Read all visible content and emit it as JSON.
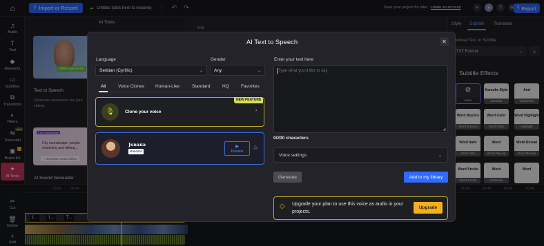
{
  "topbar": {
    "import_label": "Import or Record",
    "project_title": "Untitled (click here to rename)",
    "save_message": "Save your project for later -",
    "save_link": "create an account",
    "export_label": "Export"
  },
  "sidebar": {
    "items": [
      {
        "label": "Audio",
        "icon": "music-note-icon"
      },
      {
        "label": "Text",
        "icon": "text-icon"
      },
      {
        "label": "Elements",
        "icon": "elements-icon"
      },
      {
        "label": "Subtitles",
        "icon": "subtitles-icon"
      },
      {
        "label": "Transitions",
        "icon": "transitions-icon"
      },
      {
        "label": "Filters",
        "icon": "filters-icon"
      },
      {
        "label": "Transcript",
        "icon": "transcript-icon",
        "badge": "new"
      },
      {
        "label": "Brand Kit",
        "icon": "brand-kit-icon"
      },
      {
        "label": "AI Tools",
        "icon": "ai-tools-icon",
        "active": true
      }
    ]
  },
  "tools_panel": {
    "title": "AI Tools",
    "tts_bubble": "Hello everyone",
    "tts_title": "Text to Speech",
    "tts_desc": "Generate voiceovers for your videos",
    "snd_tag": "City Soundscape",
    "snd_text": "City soundscape, people chattering and talking...",
    "snd_btn": "+ Generate Sound Effect",
    "snd_title": "AI Sound Generator"
  },
  "canvas": {
    "ratio": "9:16"
  },
  "right_panel": {
    "tabs": [
      "Style",
      "Subtitle",
      "Translate"
    ],
    "download_text": "Download Text or Subtitle",
    "format": ".TXT Format",
    "effects_title": "Subtitle Effects",
    "effects": [
      {
        "preview": "",
        "name": "None"
      },
      {
        "preview": "Karaoke Style",
        "name": "Karaoke"
      },
      {
        "preview": "And",
        "name": "Typewriter"
      },
      {
        "preview": "Word Bounce",
        "name": "Word Bounce"
      },
      {
        "preview": "Word Color",
        "name": "Word Color"
      },
      {
        "preview": "Word Highlight",
        "name": "Highlight"
      },
      {
        "preview": "Word Italic",
        "name": "Word Italic"
      },
      {
        "preview": "Word",
        "name": "Word Pop-up"
      },
      {
        "preview": "Word Reveal",
        "name": "Word Reveal"
      },
      {
        "preview": "Word Stroke",
        "name": "Word Stroke"
      },
      {
        "preview": "Word",
        "name": "Underline"
      },
      {
        "preview": "Word",
        "name": ""
      }
    ]
  },
  "timeline": {
    "ticks": [
      "00:02",
      "00:04",
      "00:40",
      "00:42",
      "00:44",
      "00:46"
    ],
    "tools": [
      {
        "label": "Cut",
        "icon": "scissors-icon"
      },
      {
        "label": "Delete",
        "icon": "trash-icon"
      },
      {
        "label": "Add",
        "icon": "plus-icon"
      }
    ],
    "text_chips": [
      "1...",
      "1...",
      "T..."
    ]
  },
  "modal": {
    "title": "AI Text to Speech",
    "language_label": "Language",
    "language_value": "Serbian (Cyrillic)",
    "gender_label": "Gender",
    "gender_value": "Any",
    "filter_tabs": [
      "All",
      "Voice Clones",
      "Human-Like",
      "Standard",
      "HQ",
      "Favorites"
    ],
    "clone_label": "Clone your voice",
    "feature_badge": "NEW FEATURE",
    "voice": {
      "name": "Јованa",
      "tier": "standard",
      "preview": "Preview"
    },
    "text_label": "Enter your text here",
    "text_placeholder": "Type what you'd like to say",
    "char_count": "0/200 characters",
    "voice_settings": "Voice settings",
    "generate_label": "Generate",
    "add_library_label": "Add to my library",
    "upgrade_text": "Upgrade your plan to use this voice as audio in your projects.",
    "upgrade_label": "Upgrade"
  },
  "colors": {
    "accent": "#2f6bff",
    "active_sidebar": "#c9325f",
    "gold": "#f2b01e",
    "lime": "#d8de56"
  }
}
